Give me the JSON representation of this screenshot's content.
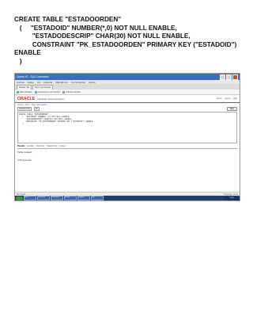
{
  "document": {
    "code_lines": [
      "CREATE TABLE \"ESTADOORDEN\"",
      "   (     \"ESTADOID\" NUMBER(*,0) NOT NULL ENABLE,",
      "          \"ESTADODESCRIP\" CHAR(30) NOT NULL ENABLE,",
      "          CONSTRAINT \"PK_ESTADOORDEN\" PRIMARY KEY (\"ESTADOID\")",
      "ENABLE",
      "   )"
    ]
  },
  "screenshot": {
    "window_title": "Oracle XE - SQL Commands",
    "menu": [
      "Archivo",
      "Editar",
      "Ver",
      "Historial",
      "Marcadores",
      "Herramientas",
      "Ayuda"
    ],
    "tabs": [
      "Oracle XE",
      "SQL Commands"
    ],
    "bookmarks": [
      "Más visitados",
      "Comenzar a usar Firefox",
      "Últimas noticias"
    ],
    "oracle_logo": "ORACLE",
    "product_name": "Database Express Edition",
    "header_links": [
      "Home",
      "Logout",
      "Help"
    ],
    "breadcrumb": "Home > SQL > SQL Commands",
    "autocommit": "Autocommit",
    "display_rows": "10",
    "run_button": "Run",
    "editor_text": "CREATE TABLE \"ESTADOORDEN\"\n   (  \"ESTADOID\" NUMBER(*,0) NOT NULL ENABLE,\n      \"ESTADODESCRIP\" CHAR(30) NOT NULL ENABLE,\n      CONSTRAINT \"PK_ESTADOORDEN\" PRIMARY KEY (\"ESTADOID\") ENABLE\n   )",
    "result_tabs": [
      "Results",
      "Explain",
      "Describe",
      "Saved SQL",
      "History"
    ],
    "result_lines": [
      "Table created.",
      "",
      "0.05 seconds"
    ],
    "status_left": "Terminado",
    "status_right": "Language: en-us",
    "taskbar_items": [
      "Inicio",
      "Oracle XE",
      "Documento",
      "Mozilla",
      "Carpeta",
      "SQL"
    ],
    "clock": "12:00"
  }
}
